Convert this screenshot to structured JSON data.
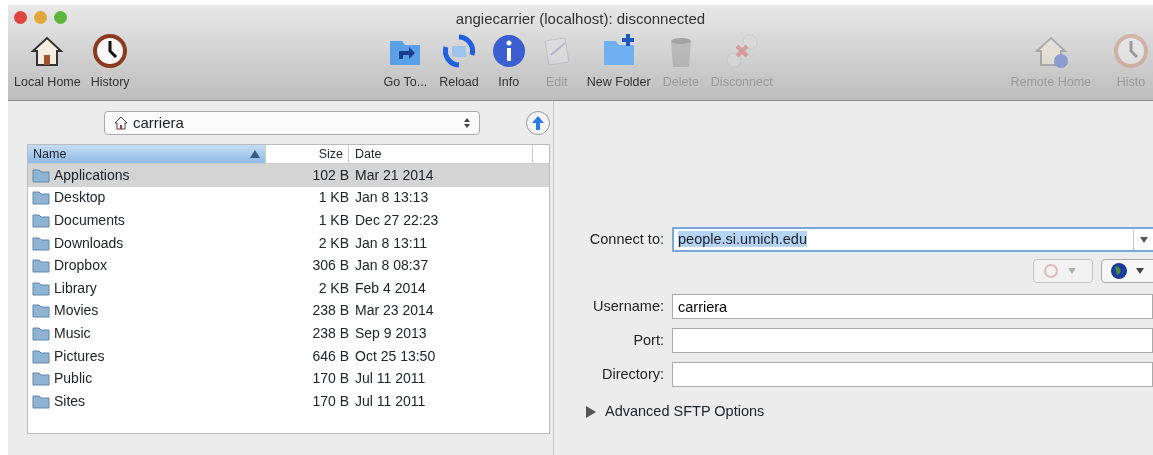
{
  "window": {
    "title": "angiecarrier (localhost): disconnected"
  },
  "toolbar": {
    "left": [
      {
        "label": "Local Home",
        "disabled": false
      },
      {
        "label": "History",
        "disabled": false
      }
    ],
    "center": [
      {
        "label": "Go To...",
        "disabled": false
      },
      {
        "label": "Reload",
        "disabled": false
      },
      {
        "label": "Info",
        "disabled": false
      },
      {
        "label": "Edit",
        "disabled": true
      },
      {
        "label": "New Folder",
        "disabled": false
      },
      {
        "label": "Delete",
        "disabled": true
      },
      {
        "label": "Disconnect",
        "disabled": true
      }
    ],
    "right": [
      {
        "label": "Remote Home",
        "disabled": true
      },
      {
        "label": "Histo",
        "disabled": true
      }
    ]
  },
  "location": {
    "value": "carriera"
  },
  "table": {
    "columns": [
      {
        "label": "Name",
        "sorted": true
      },
      {
        "label": "Size",
        "sorted": false
      },
      {
        "label": "Date",
        "sorted": false
      }
    ],
    "rows": [
      {
        "name": "Applications",
        "size": "102 B",
        "date": "Mar 21 2014",
        "selected": true
      },
      {
        "name": "Desktop",
        "size": "1 KB",
        "date": "Jan 8 13:13",
        "selected": false
      },
      {
        "name": "Documents",
        "size": "1 KB",
        "date": "Dec 27 22:23",
        "selected": false
      },
      {
        "name": "Downloads",
        "size": "2 KB",
        "date": "Jan 8 13:11",
        "selected": false
      },
      {
        "name": "Dropbox",
        "size": "306 B",
        "date": "Jan 8 08:37",
        "selected": false
      },
      {
        "name": "Library",
        "size": "2 KB",
        "date": "Feb 4 2014",
        "selected": false
      },
      {
        "name": "Movies",
        "size": "238 B",
        "date": "Mar 23 2014",
        "selected": false
      },
      {
        "name": "Music",
        "size": "238 B",
        "date": "Sep 9 2013",
        "selected": false
      },
      {
        "name": "Pictures",
        "size": "646 B",
        "date": "Oct 25 13:50",
        "selected": false
      },
      {
        "name": "Public",
        "size": "170 B",
        "date": "Jul 11 2011",
        "selected": false
      },
      {
        "name": "Sites",
        "size": "170 B",
        "date": "Jul 11 2011",
        "selected": false
      }
    ]
  },
  "connect": {
    "label": "Connect to:",
    "value": "people.si.umich.edu",
    "value_highlighted": true
  },
  "fields": [
    {
      "label": "Username:",
      "value": "carriera"
    },
    {
      "label": "Port:"
    },
    {
      "label": "Directory:"
    }
  ],
  "advanced": {
    "label": "Advanced SFTP Options",
    "expanded": false
  }
}
